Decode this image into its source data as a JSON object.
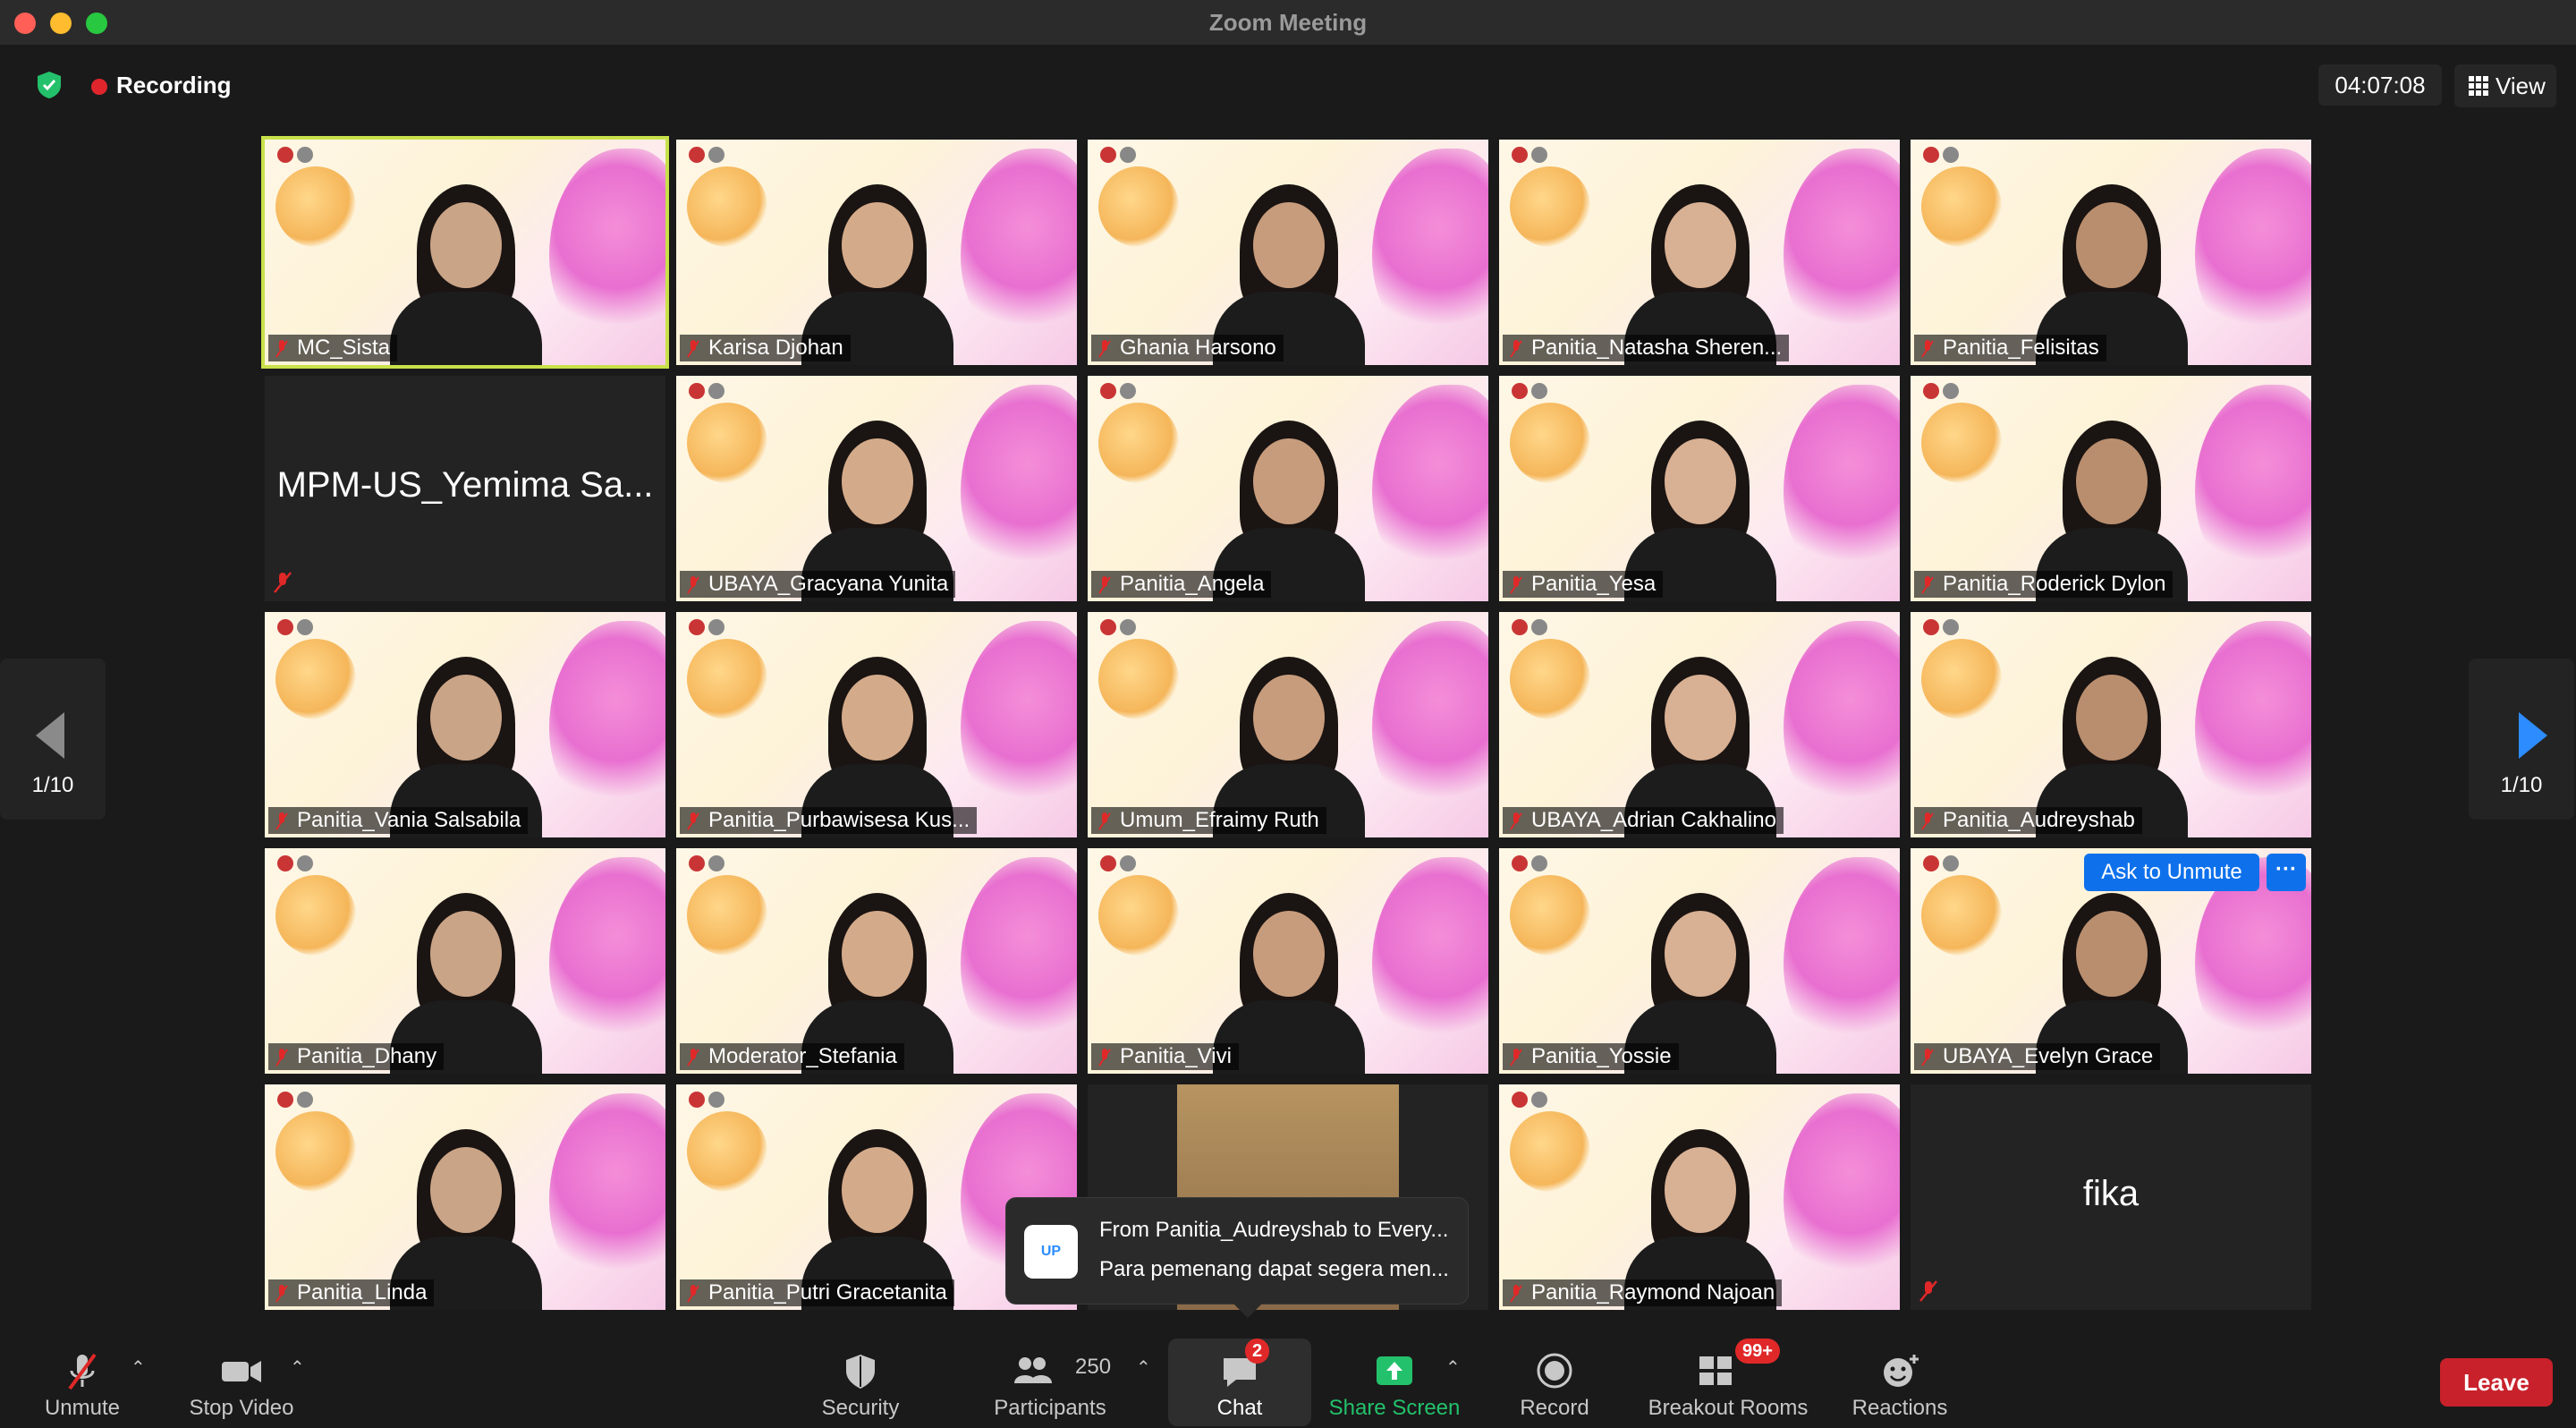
{
  "window": {
    "title": "Zoom Meeting"
  },
  "status": {
    "recording_label": "Recording",
    "timer": "04:07:08",
    "view_label": "View"
  },
  "pager": {
    "left_page": "1/10",
    "right_page": "1/10"
  },
  "tiles": [
    {
      "name": "MC_Sista",
      "type": "video",
      "active": true
    },
    {
      "name": "Karisa Djohan",
      "type": "video"
    },
    {
      "name": "Ghania Harsono",
      "type": "video"
    },
    {
      "name": "Panitia_Natasha Sheren...",
      "type": "video"
    },
    {
      "name": "Panitia_Felisitas",
      "type": "video"
    },
    {
      "name": "MPM-US_Yemima Sa...",
      "type": "name-only"
    },
    {
      "name": "UBAYA_Gracyana Yunita",
      "type": "video"
    },
    {
      "name": "Panitia_Angela",
      "type": "video"
    },
    {
      "name": "Panitia_Yesa",
      "type": "video"
    },
    {
      "name": "Panitia_Roderick Dylon",
      "type": "video"
    },
    {
      "name": "Panitia_Vania Salsabila",
      "type": "video"
    },
    {
      "name": "Panitia_Purbawisesa Kus...",
      "type": "video"
    },
    {
      "name": "Umum_Efraimy Ruth",
      "type": "video"
    },
    {
      "name": "UBAYA_Adrian Cakhalino",
      "type": "video"
    },
    {
      "name": "Panitia_Audreyshab",
      "type": "video"
    },
    {
      "name": "Panitia_Dhany",
      "type": "video"
    },
    {
      "name": "Moderator_Stefania",
      "type": "video"
    },
    {
      "name": "Panitia_Vivi",
      "type": "video"
    },
    {
      "name": "Panitia_Yossie",
      "type": "video"
    },
    {
      "name": "UBAYA_Evelyn Grace",
      "type": "video"
    },
    {
      "name": "Panitia_Linda",
      "type": "video"
    },
    {
      "name": "Panitia_Putri Gracetanita",
      "type": "video"
    },
    {
      "name": "",
      "type": "video"
    },
    {
      "name": "Panitia_Raymond Najoan",
      "type": "video"
    },
    {
      "name": "fika",
      "type": "name-only"
    }
  ],
  "tile_actions": {
    "ask_to_unmute": "Ask to Unmute",
    "more": "···"
  },
  "chat_toast": {
    "from": "From Panitia_Audreyshab to Every...",
    "message": "Para pemenang dapat segera men...",
    "avatar_text": "UP"
  },
  "toolbar": {
    "unmute": "Unmute",
    "stop_video": "Stop Video",
    "security": "Security",
    "participants": "Participants",
    "participants_count": "250",
    "chat": "Chat",
    "chat_badge": "2",
    "share_screen": "Share Screen",
    "record": "Record",
    "breakout_rooms": "Breakout Rooms",
    "breakout_badge": "99+",
    "reactions": "Reactions",
    "leave": "Leave"
  },
  "colors": {
    "accent": "#2d8cff",
    "share": "#23c16b",
    "leave": "#c8212b",
    "active_speaker": "#c8e14a",
    "recording": "#e0262c"
  }
}
